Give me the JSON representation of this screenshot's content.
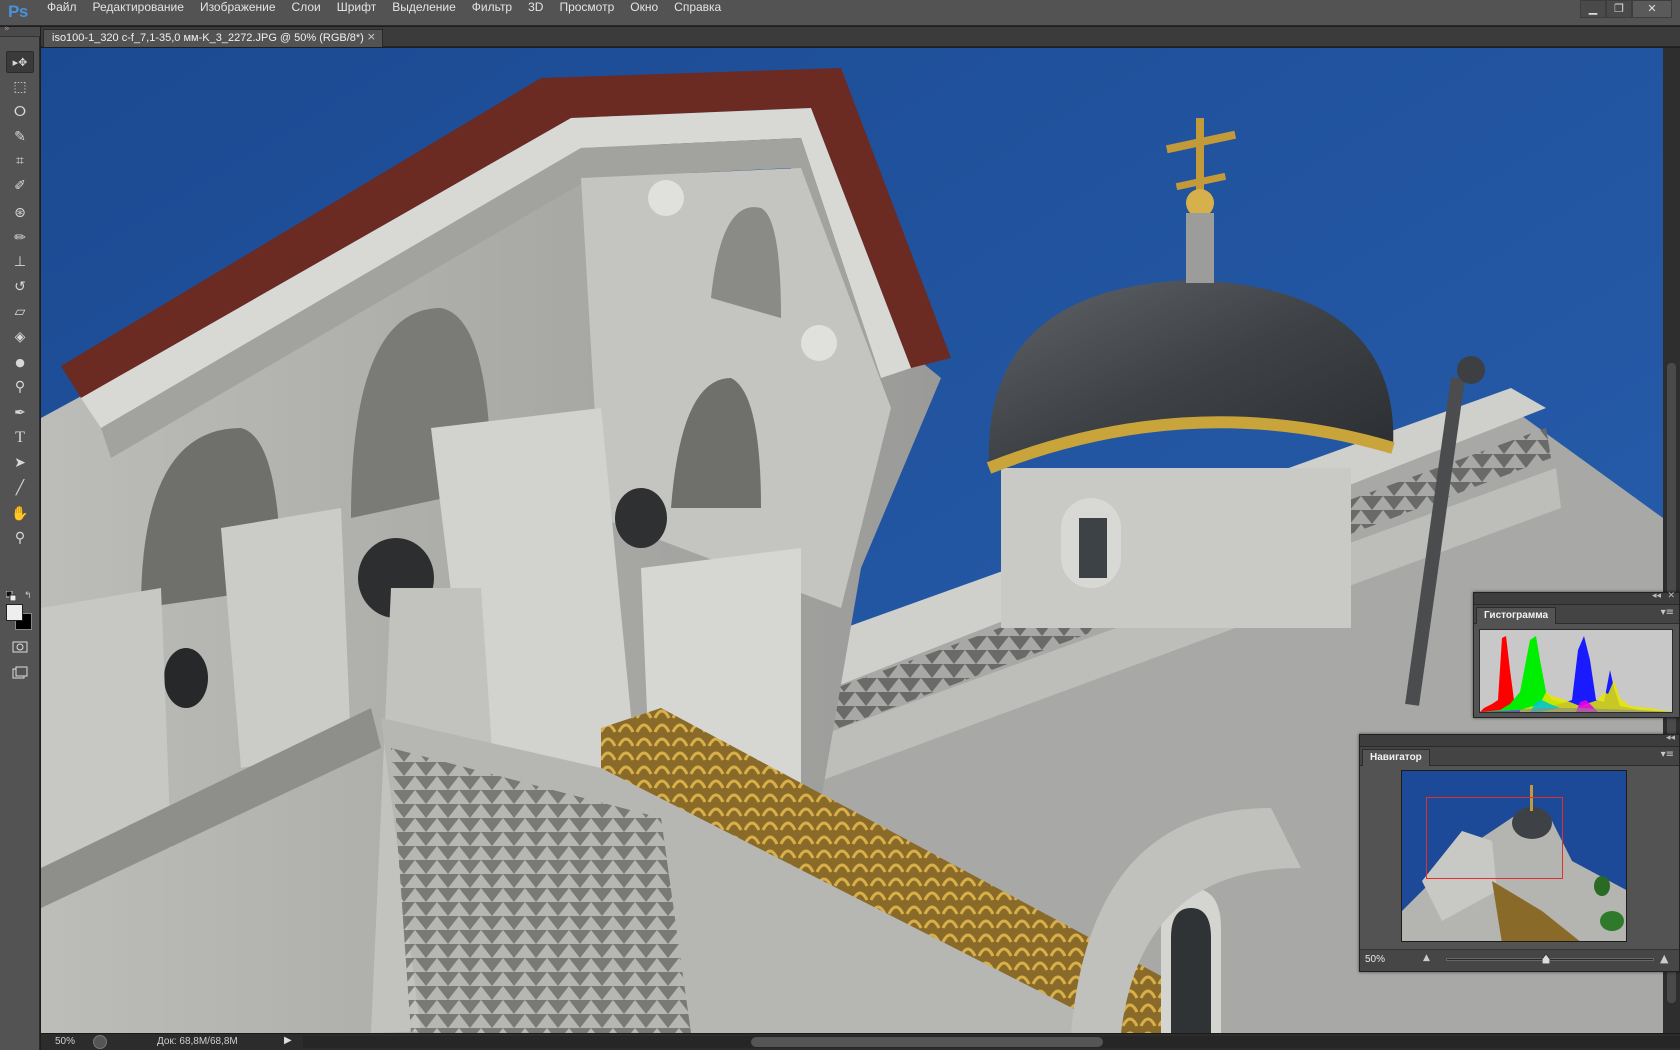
{
  "app": {
    "logo": "Ps"
  },
  "menu": [
    "Файл",
    "Редактирование",
    "Изображение",
    "Слои",
    "Шрифт",
    "Выделение",
    "Фильтр",
    "3D",
    "Просмотр",
    "Окно",
    "Справка"
  ],
  "window_controls": {
    "minimize": "▁",
    "restore": "❐",
    "close": "✕"
  },
  "document": {
    "tab_title": "iso100-1_320 c-f_7,1-35,0 мм-K_3_2272.JPG @ 50% (RGB/8*)",
    "close_glyph": "×"
  },
  "tools": [
    {
      "name": "move-tool-icon",
      "glyph": "▸✥"
    },
    {
      "name": "marquee-tool-icon",
      "glyph": "⬚"
    },
    {
      "name": "lasso-tool-icon",
      "glyph": "ⵔ"
    },
    {
      "name": "quick-select-tool-icon",
      "glyph": "✎"
    },
    {
      "name": "crop-tool-icon",
      "glyph": "⌗"
    },
    {
      "name": "eyedropper-tool-icon",
      "glyph": "✐"
    },
    {
      "name": "spot-healing-tool-icon",
      "glyph": "⊛"
    },
    {
      "name": "brush-tool-icon",
      "glyph": "✏"
    },
    {
      "name": "stamp-tool-icon",
      "glyph": "⊥"
    },
    {
      "name": "history-brush-tool-icon",
      "glyph": "↺"
    },
    {
      "name": "eraser-tool-icon",
      "glyph": "▱"
    },
    {
      "name": "paint-bucket-tool-icon",
      "glyph": "◈"
    },
    {
      "name": "blur-tool-icon",
      "glyph": "●"
    },
    {
      "name": "dodge-tool-icon",
      "glyph": "⚲"
    },
    {
      "name": "pen-tool-icon",
      "glyph": "✒"
    },
    {
      "name": "type-tool-icon",
      "glyph": "T"
    },
    {
      "name": "path-select-tool-icon",
      "glyph": "➤"
    },
    {
      "name": "line-tool-icon",
      "glyph": "╱"
    },
    {
      "name": "hand-tool-icon",
      "glyph": "✋"
    },
    {
      "name": "zoom-tool-icon",
      "glyph": "⚲"
    }
  ],
  "colors": {
    "foreground": "#eeeeee",
    "background": "#000000",
    "accent": "#4a90d9",
    "nav_box": "#e03030"
  },
  "status": {
    "zoom": "50%",
    "doc_size": "Док: 68,8M/68,8M"
  },
  "histogram": {
    "title": "Гистограмма",
    "warning_icon": "warning-icon"
  },
  "navigator": {
    "title": "Навигатор",
    "zoom": "50%"
  }
}
